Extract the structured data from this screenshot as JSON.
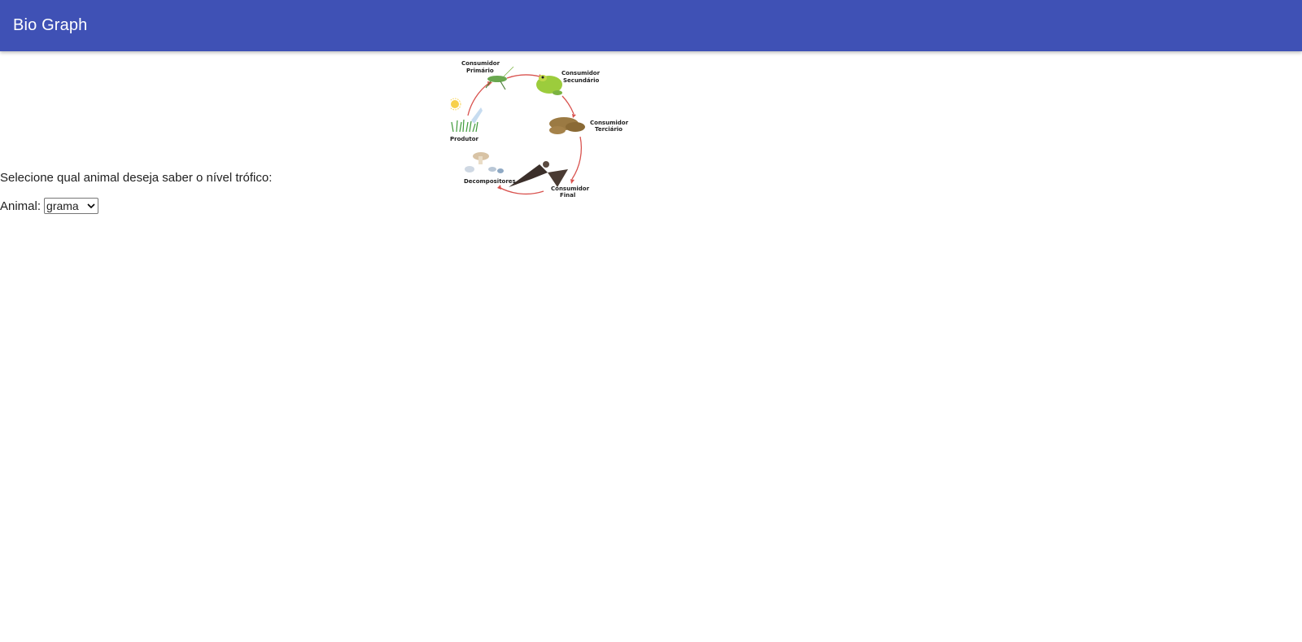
{
  "header": {
    "title": "Bio Graph",
    "color": "#3f51b5"
  },
  "diagram": {
    "labels": {
      "primary": [
        "Consumidor",
        "Primário"
      ],
      "secondary": [
        "Consumidor",
        "Secundário"
      ],
      "tertiary": [
        "Consumidor",
        "Terciário"
      ],
      "final": [
        "Consumidor",
        "Final"
      ],
      "decomposers": "Decompositores",
      "producer": "Produtor"
    }
  },
  "form": {
    "prompt": "Selecione qual animal deseja saber o nível trófico:",
    "animal_label": "Animal:",
    "animal_selected": "grama"
  }
}
